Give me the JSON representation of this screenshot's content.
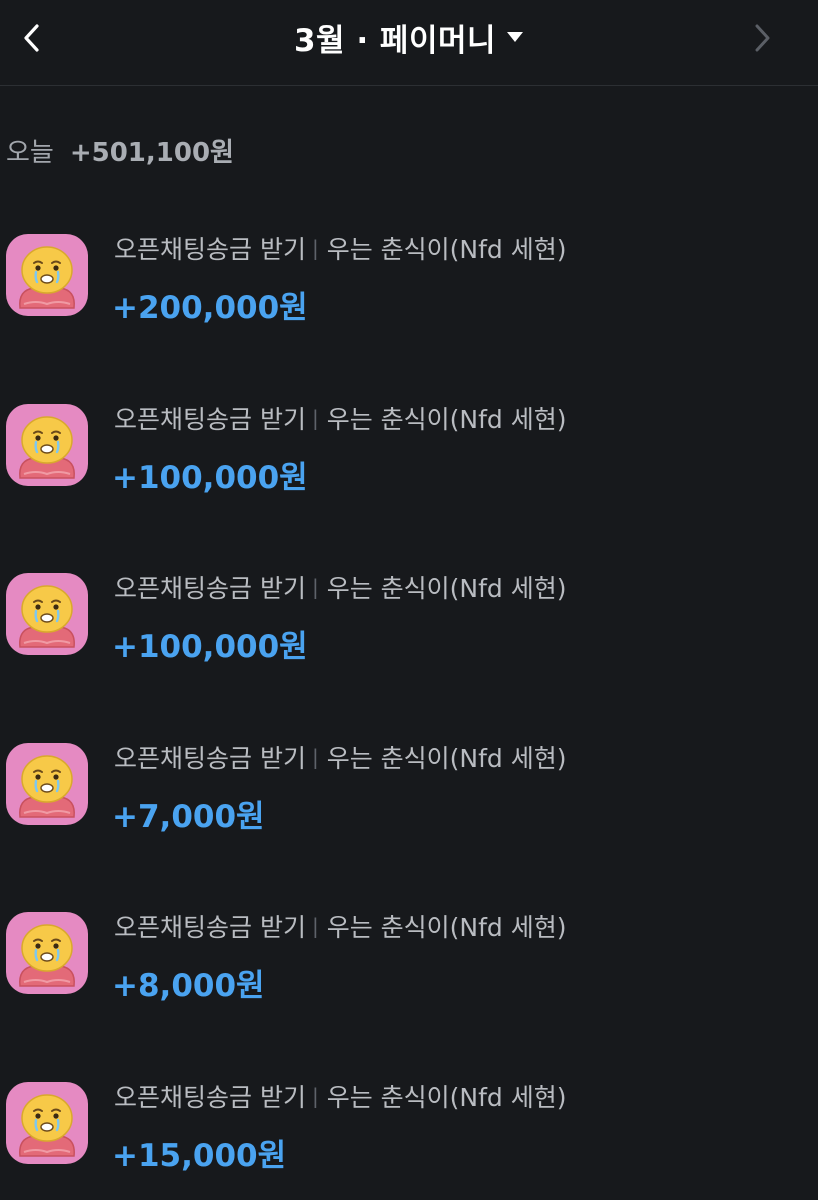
{
  "header": {
    "back_icon": "chevron-left-icon",
    "title": "3월 · 페이머니",
    "dropdown_icon": "caret-down-icon",
    "next_icon": "chevron-right-icon"
  },
  "day": {
    "label": "오늘",
    "total": "+501,100원"
  },
  "transactions": [
    {
      "type": "오픈채팅송금 받기",
      "separator": "|",
      "sender": "우는 춘식이(Nfd 세현)",
      "amount": "+200,000원"
    },
    {
      "type": "오픈채팅송금 받기",
      "separator": "|",
      "sender": "우는 춘식이(Nfd 세현)",
      "amount": "+100,000원"
    },
    {
      "type": "오픈채팅송금 받기",
      "separator": "|",
      "sender": "우는 춘식이(Nfd 세현)",
      "amount": "+100,000원"
    },
    {
      "type": "오픈채팅송금 받기",
      "separator": "|",
      "sender": "우는 춘식이(Nfd 세현)",
      "amount": "+7,000원"
    },
    {
      "type": "오픈채팅송금 받기",
      "separator": "|",
      "sender": "우는 춘식이(Nfd 세현)",
      "amount": "+8,000원"
    },
    {
      "type": "오픈채팅송금 받기",
      "separator": "|",
      "sender": "우는 춘식이(Nfd 세현)",
      "amount": "+15,000원"
    }
  ],
  "colors": {
    "background": "#17191c",
    "amount_positive": "#4aa3f0",
    "avatar_bg": "#e58ac2",
    "character_face": "#f7c948"
  }
}
